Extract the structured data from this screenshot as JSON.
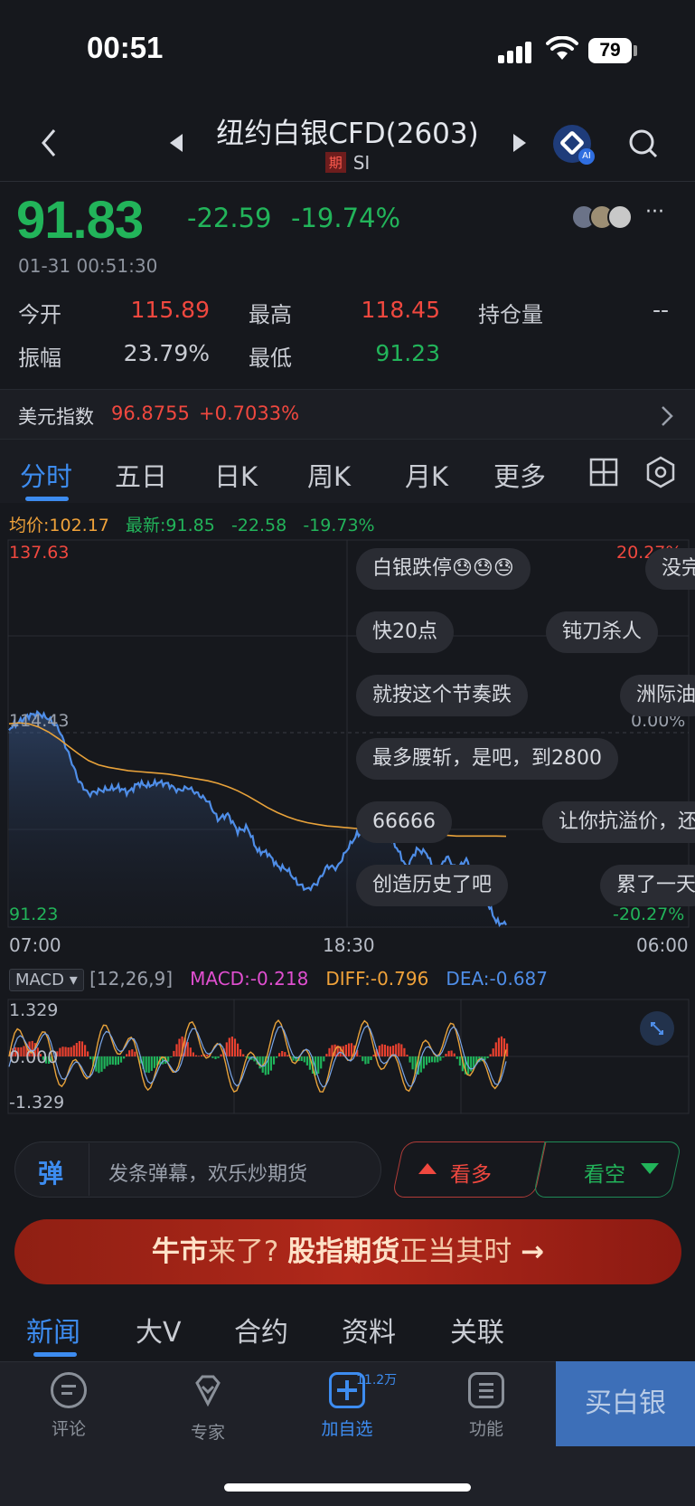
{
  "status_bar": {
    "time": "00:51",
    "battery": "79"
  },
  "nav": {
    "title": "纽约白银CFD(2603)",
    "tag": "期",
    "symbol": "SI",
    "ai_badge": "AI"
  },
  "quote": {
    "price": "91.83",
    "change": "-22.59",
    "change_pct": "-19.74%",
    "timestamp": "01-31 00:51:30",
    "more": "···",
    "stats": [
      {
        "label": "今开",
        "value": "115.89",
        "color": "#f0483f"
      },
      {
        "label": "最高",
        "value": "118.45",
        "color": "#f0483f"
      },
      {
        "label": "持仓量",
        "value": "--",
        "color": "#c9ccd3"
      },
      {
        "label": "振幅",
        "value": "23.79%",
        "color": "#c9ccd3"
      },
      {
        "label": "最低",
        "value": "91.23",
        "color": "#22b45a"
      }
    ]
  },
  "dxy": {
    "label": "美元指数",
    "value": "96.8755",
    "change": "+0.7033%"
  },
  "tabs": [
    "分时",
    "五日",
    "日K",
    "周K",
    "月K",
    "更多"
  ],
  "chart_legend": {
    "avg": "均价:102.17",
    "latest": "最新:91.85",
    "chg": "-22.58",
    "pct": "-19.73%"
  },
  "chart_axis": {
    "y_top": "137.63",
    "y_mid": "114.43",
    "y_bottom": "91.23",
    "pct_top": "20.27%",
    "pct_mid": "0.00%",
    "pct_bottom": "-20.27%",
    "x_labels": [
      "07:00",
      "18:30",
      "06:00"
    ]
  },
  "chart_data": {
    "type": "line",
    "x": [
      "07:00",
      "18:30",
      "06:00"
    ],
    "ylim": [
      91.23,
      137.63
    ],
    "series": [
      {
        "values": [
          115.0,
          115.8,
          116.6,
          116.8,
          116.2,
          115.0,
          112.0,
          108.8,
          107.2,
          107.6,
          107.8,
          108.0,
          107.4,
          108.5,
          108.2,
          108.6,
          108.4,
          107.6,
          108.0,
          107.2,
          106.4,
          104.2,
          104.8,
          102.8,
          103.2,
          100.4,
          100.2,
          98.6,
          98.2,
          96.6,
          95.8,
          96.6,
          98.6,
          98.4,
          100.6,
          102.4,
          102.8,
          103.4,
          102.6,
          100.8,
          98.4,
          100.6,
          100.2,
          97.4,
          99.8,
          98.2,
          99.4,
          96.6,
          94.6,
          92.0,
          91.6
        ]
      },
      {
        "values": [
          115.6,
          115.7,
          115.6,
          115.2,
          114.6,
          113.8,
          112.9,
          112.0,
          111.2,
          110.7,
          110.4,
          110.2,
          110.0,
          109.9,
          109.8,
          109.7,
          109.6,
          109.4,
          109.2,
          109.0,
          108.8,
          108.5,
          108.1,
          107.6,
          107.0,
          106.3,
          105.6,
          105.0,
          104.5,
          104.1,
          103.8,
          103.6,
          103.4,
          103.3,
          103.2,
          103.1,
          103.0,
          102.9,
          102.8,
          102.7,
          102.6,
          102.5,
          102.4,
          102.3,
          102.3,
          102.2,
          102.2,
          102.2,
          102.2,
          102.2,
          102.17
        ]
      }
    ]
  },
  "danmaku": [
    "白银跌停😓😓😓",
    "没完",
    "快20点",
    "钝刀杀人",
    "就按这个节奏跌",
    "洲际油",
    "最多腰斩，是吧，到2800",
    "66666",
    "让你抗溢价，还",
    "创造历史了吧",
    "累了一天"
  ],
  "macd": {
    "select": "MACD",
    "params": "[12,26,9]",
    "macd": "MACD:-0.218",
    "diff": "DIFF:-0.796",
    "dea": "DEA:-0.687",
    "y_top": "1.329",
    "y_mid": "0.000",
    "y_bottom": "-1.329"
  },
  "actions": {
    "danmu_icon": "弹",
    "danmu_placeholder": "发条弹幕，欢乐炒期货",
    "bull": "看多",
    "bear": "看空"
  },
  "banner": {
    "part1": "牛市",
    "part2": "来了?",
    "part3": "股指期货",
    "part4": "正当其时",
    "arrow": "→"
  },
  "news_tabs": [
    "新闻",
    "大V",
    "合约",
    "资料",
    "关联"
  ],
  "bottom": {
    "items": [
      "评论",
      "专家",
      "加自选",
      "功能"
    ],
    "watch_count": "11.2万",
    "buy": "买白银"
  }
}
